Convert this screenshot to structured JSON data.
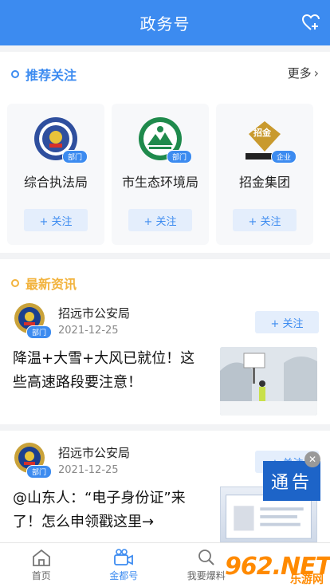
{
  "header": {
    "title": "政务号"
  },
  "recommend": {
    "title": "推荐关注",
    "more": "更多",
    "cards": [
      {
        "name": "综合执法局",
        "badge": "部门",
        "follow": "+ 关注",
        "icon": "enforcement-emblem-icon"
      },
      {
        "name": "市生态环境局",
        "badge": "部门",
        "follow": "+ 关注",
        "icon": "ecology-emblem-icon"
      },
      {
        "name": "招金集团",
        "badge": "企业",
        "follow": "+ 关注",
        "icon": "zhaojin-logo-icon",
        "logo_text": "招金"
      }
    ]
  },
  "news": {
    "title": "最新资讯",
    "items": [
      {
        "source": "招远市公安局",
        "badge": "部门",
        "date": "2021-12-25",
        "follow": "+ 关注",
        "headline": "降温+大雪+大风已就位！这些高速路段要注意！"
      },
      {
        "source": "招远市公安局",
        "badge": "部门",
        "date": "2021-12-25",
        "follow": "+ 关注",
        "headline": "@山东人：“电子身份证”来了！怎么申领戳这里→"
      }
    ]
  },
  "notice": {
    "label": "通告"
  },
  "tabs": [
    {
      "label": "首页",
      "icon": "home-icon",
      "active": false
    },
    {
      "label": "金都号",
      "icon": "camera-icon",
      "active": true
    },
    {
      "label": "我要爆料",
      "icon": "search-icon",
      "active": false
    }
  ],
  "watermark": {
    "num": "962.NET",
    "text": "乐游网"
  },
  "colors": {
    "primary": "#3c8bf0",
    "accent": "#f2b33d"
  }
}
